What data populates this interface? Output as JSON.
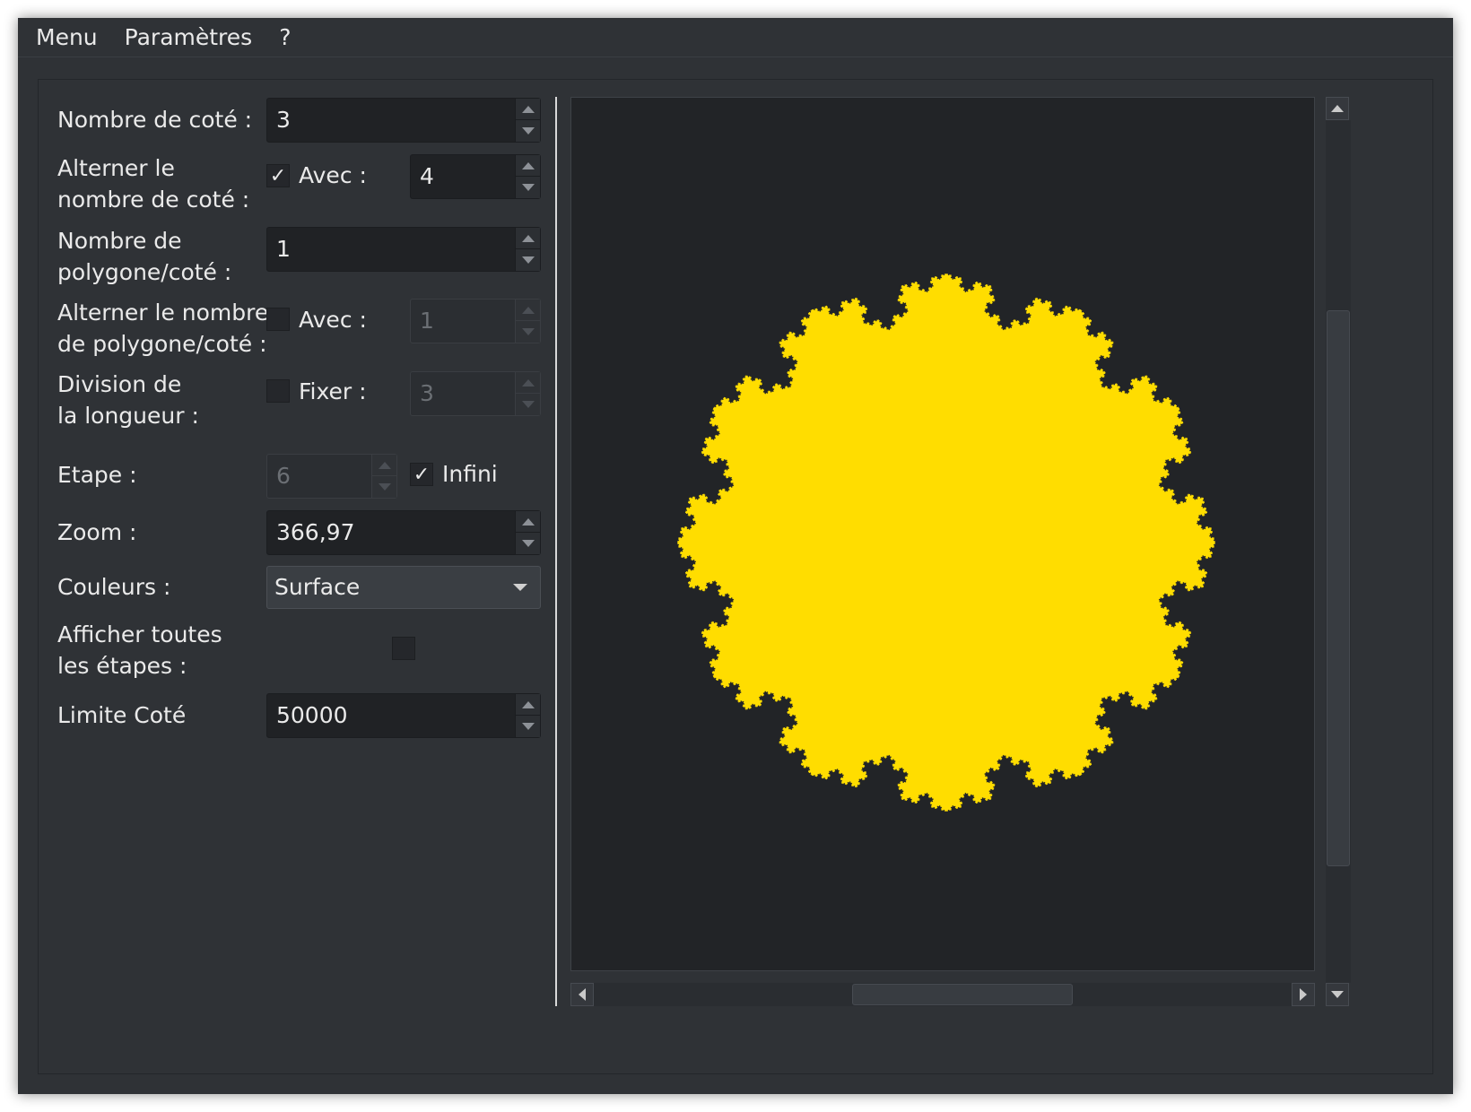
{
  "menubar": {
    "items": [
      "Menu",
      "Paramètres",
      "?"
    ]
  },
  "form": {
    "sides_label": "Nombre de coté :",
    "sides_value": "3",
    "alt_sides_label_1": "Alterner le",
    "alt_sides_label_2": "nombre de coté :",
    "alt_sides_checked": "✓",
    "alt_sides_with_label": "Avec :",
    "alt_sides_value": "4",
    "polys_label_1": "Nombre de",
    "polys_label_2": "polygone/coté :",
    "polys_value": "1",
    "alt_polys_label_1": "Alterner le nombre",
    "alt_polys_label_2": "de polygone/coté :",
    "alt_polys_with_label": "Avec :",
    "alt_polys_value": "1",
    "division_label_1": "Division de",
    "division_label_2": "la longueur :",
    "division_fix_label": "Fixer :",
    "division_value": "3",
    "step_label": "Etape :",
    "step_value": "6",
    "infinite_checked": "✓",
    "infinite_label": "Infini",
    "zoom_label": "Zoom :",
    "zoom_value": "366,97",
    "colors_label": "Couleurs :",
    "colors_value": "Surface",
    "show_steps_label_1": "Afficher toutes",
    "show_steps_label_2": "les étapes :",
    "limit_label": "Limite Coté",
    "limit_value": "50000"
  },
  "fractal": {
    "fill_color": "#FFDD00",
    "background": "#222427",
    "outer_sides": 12,
    "depth": 5
  }
}
